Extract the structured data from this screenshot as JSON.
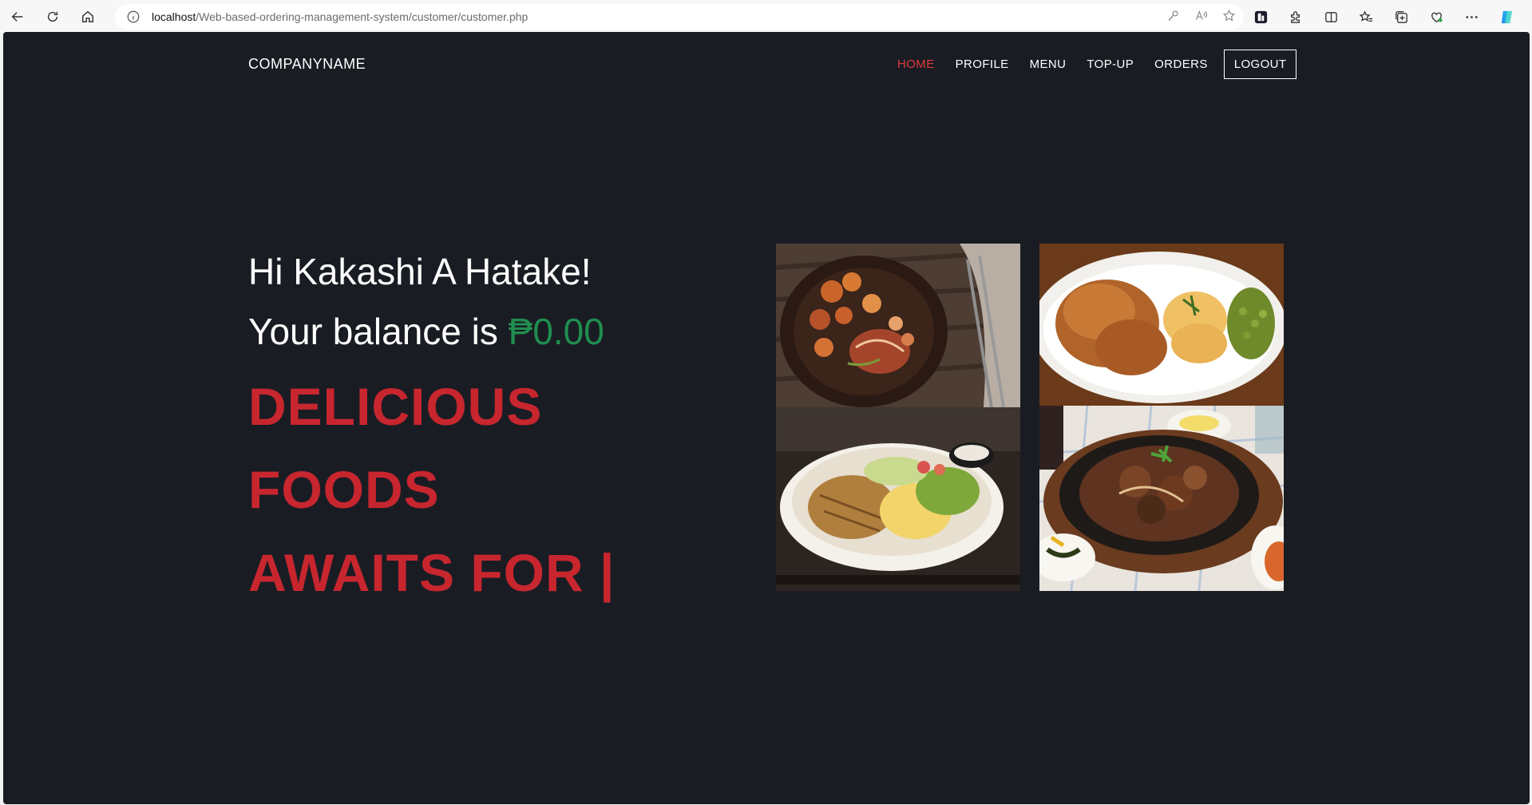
{
  "browser": {
    "url_host": "localhost",
    "url_path": "/Web-based-ordering-management-system/customer/customer.php"
  },
  "navbar": {
    "brand": "COMPANYNAME",
    "links": [
      {
        "label": "HOME",
        "active": true
      },
      {
        "label": "PROFILE",
        "active": false
      },
      {
        "label": "MENU",
        "active": false
      },
      {
        "label": "TOP-UP",
        "active": false
      },
      {
        "label": "ORDERS",
        "active": false
      }
    ],
    "logout_label": "LOGOUT"
  },
  "hero": {
    "greeting": "Hi Kakashi A Hatake!",
    "balance_prefix": "Your balance is",
    "balance_amount": "₱0.00",
    "tagline_line1": "DELICIOUS FOODS",
    "tagline_line2": "AWAITS FOR |"
  },
  "colors": {
    "page_bg": "#1a1c23",
    "active_link": "#e03a3e",
    "balance": "#1f8e4f",
    "tagline": "#c7262f"
  },
  "images": [
    {
      "icon": "grilled-shrimp-potatoes-photo"
    },
    {
      "icon": "fried-chicken-mac-peas-photo"
    },
    {
      "icon": "chicken-salad-photo"
    },
    {
      "icon": "sizzling-beef-photo"
    }
  ]
}
